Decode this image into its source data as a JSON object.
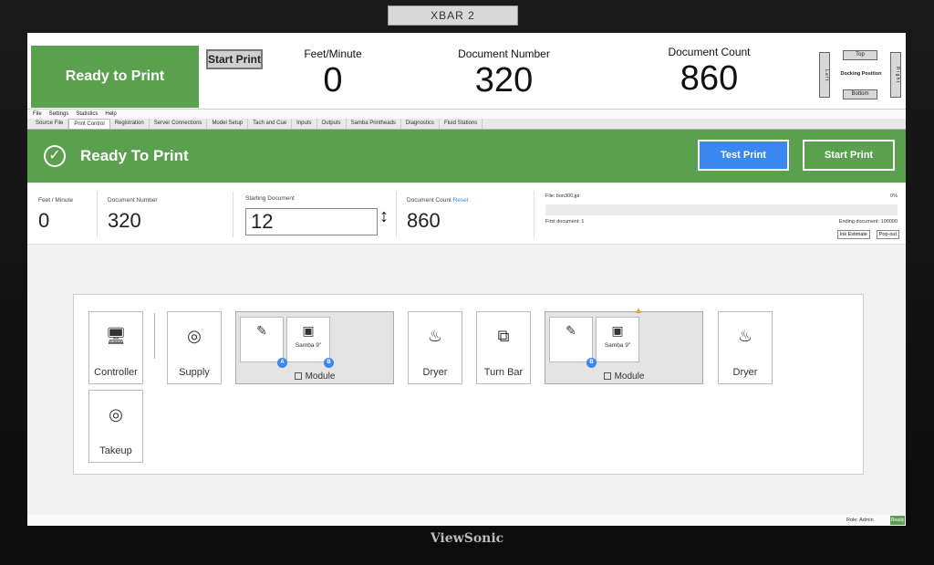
{
  "monitor": {
    "label": "XBAR 2",
    "brand": "ViewSonic"
  },
  "top": {
    "status": "Ready to Print",
    "start_label": "Start Print",
    "feet_label": "Feet/Minute",
    "feet_value": "0",
    "docnum_label": "Document Number",
    "docnum_value": "320",
    "doccount_label": "Document Count",
    "doccount_value": "860",
    "dock": {
      "left": "L e f t",
      "right": "R i g h t",
      "top": "Top",
      "bottom": "Bottom",
      "position": "Docking Position"
    }
  },
  "menu": [
    "File",
    "Settings",
    "Statistics",
    "Help"
  ],
  "tabs": [
    "Source File",
    "Print Control",
    "Registration",
    "Server Connections",
    "Model Setup",
    "Tach and Cue",
    "Inputs",
    "Outputs",
    "Samba Printheads",
    "Diagnostics",
    "Fluid Stations"
  ],
  "banner": {
    "title": "Ready To Print",
    "test_label": "Test Print",
    "start_label": "Start Print"
  },
  "stats": {
    "feet_label": "Feet / Minute",
    "feet_value": "0",
    "docnum_label": "Document Number",
    "docnum_value": "320",
    "startdoc_label": "Starting Document",
    "startdoc_value": "12",
    "doccount_label": "Document Count",
    "reset_label": "Reset",
    "doccount_value": "860",
    "file_label": "File: bon300.jpi",
    "percent": "0%",
    "first_doc": "First document: 1",
    "ending_doc": "Ending document: 100000",
    "ink_estimate": "Ink Estimate",
    "popout": "Pop-out"
  },
  "layout": {
    "controller": "Controller",
    "supply": "Supply",
    "module_a": {
      "head": "Samba 9\"",
      "name": "Module",
      "dot1": "A",
      "dot2": "B"
    },
    "dryer1": "Dryer",
    "turnbar": "Turn Bar",
    "module_b": {
      "head": "Samba 9\"",
      "name": "Module",
      "dot": "B"
    },
    "dryer2": "Dryer",
    "takeup": "Takeup"
  },
  "footer": {
    "role": "Role: Admin",
    "status": "Ready"
  }
}
